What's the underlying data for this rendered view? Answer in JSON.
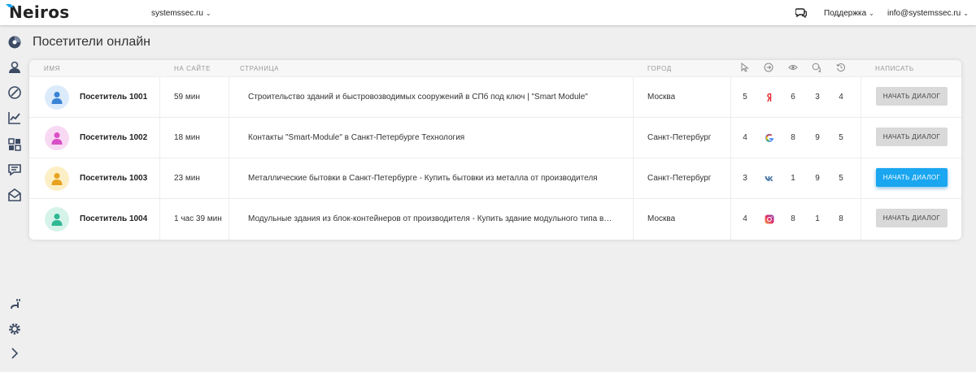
{
  "header": {
    "logo": "Neiros",
    "site": "systemssec.ru",
    "support": "Поддержка",
    "account": "info@systemssec.ru"
  },
  "page_title": "Посетители онлайн",
  "table": {
    "columns": {
      "name": "ИМЯ",
      "time": "НА САЙТЕ",
      "page": "СТРАНИЦА",
      "city": "ГОРОД",
      "write": "НАПИСАТЬ"
    },
    "icon_columns": [
      "cursor-icon",
      "arrow-circle-icon",
      "eye-icon",
      "chat-bubbles-icon",
      "history-icon"
    ],
    "rows": [
      {
        "name": "Посетитель 1001",
        "time": "59 мин",
        "page": "Строительство зданий и быстровозводимых сооружений в СПб под ключ  | \"Smart Module\"",
        "city": "Москва",
        "clicks": "5",
        "source": "yandex-icon",
        "views": "6",
        "chats": "3",
        "visits": "4",
        "button": "НАЧАТЬ ДИАЛОГ",
        "avatar_bg": "#dcebfb",
        "avatar_fg": "#3b83d6"
      },
      {
        "name": "Посетитель 1002",
        "time": "18 мин",
        "page": "Контакты \"Smart-Module\" в Санкт-Петербурге Технология",
        "city": "Санкт-Петербург",
        "clicks": "4",
        "source": "google-icon",
        "views": "8",
        "chats": "9",
        "visits": "5",
        "button": "НАЧАТЬ ДИАЛОГ",
        "avatar_bg": "#f8d9f3",
        "avatar_fg": "#d94fc6"
      },
      {
        "name": "Посетитель 1003",
        "time": "23 мин",
        "page": "Металлические бытовки в Санкт-Петербурге - Купить бытовки из металла от производителя",
        "city": "Санкт-Петербург",
        "clicks": "3",
        "source": "vk-icon",
        "views": "1",
        "chats": "9",
        "visits": "5",
        "button": "НАЧАТЬ ДИАЛОГ",
        "avatar_bg": "#fcefc6",
        "avatar_fg": "#e8a21f"
      },
      {
        "name": "Посетитель 1004",
        "time": "1 час 39 мин",
        "page": "Модульные здания из блок-контейнеров от производителя - Купить здание модульного типа в Санкт-Петербурге",
        "city": "Москва",
        "clicks": "4",
        "source": "instagram-icon",
        "views": "8",
        "chats": "1",
        "visits": "8",
        "button": "НАЧАТЬ ДИАЛОГ",
        "avatar_bg": "#d6f3ea",
        "avatar_fg": "#2eb894"
      }
    ]
  },
  "colors": {
    "accent": "#1aa6f0",
    "sidebar_icon": "#3c4a63",
    "button_default": "#d9d9d9"
  }
}
